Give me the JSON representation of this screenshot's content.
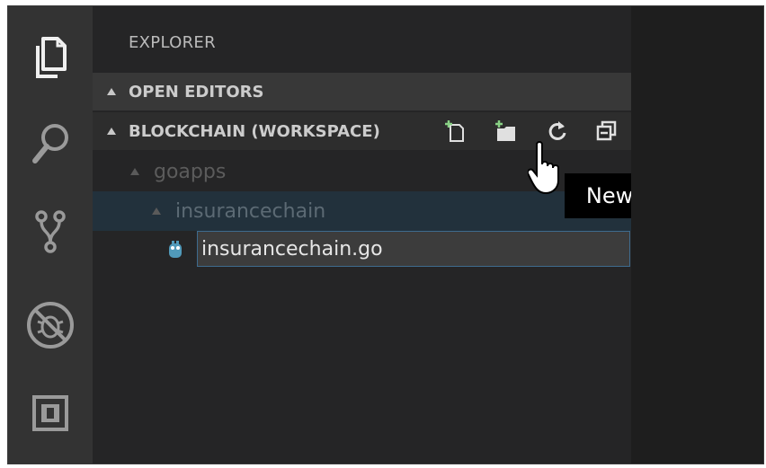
{
  "sidebar": {
    "title": "EXPLORER",
    "sections": {
      "open_editors": "OPEN EDITORS",
      "workspace": "BLOCKCHAIN (WORKSPACE)"
    },
    "tree": {
      "folder1": "goapps",
      "folder2": "insurancechain",
      "new_file_value": "insurancechain.go"
    }
  },
  "tooltip": {
    "text": "New File"
  },
  "icons": {
    "activity": [
      "explorer-icon",
      "search-icon",
      "source-control-icon",
      "debug-icon",
      "extensions-icon"
    ],
    "toolbar": [
      "new-file-icon",
      "new-folder-icon",
      "refresh-icon",
      "collapse-all-icon"
    ]
  },
  "colors": {
    "accent_plus": "#89d185",
    "file_icon": "#519aba"
  }
}
